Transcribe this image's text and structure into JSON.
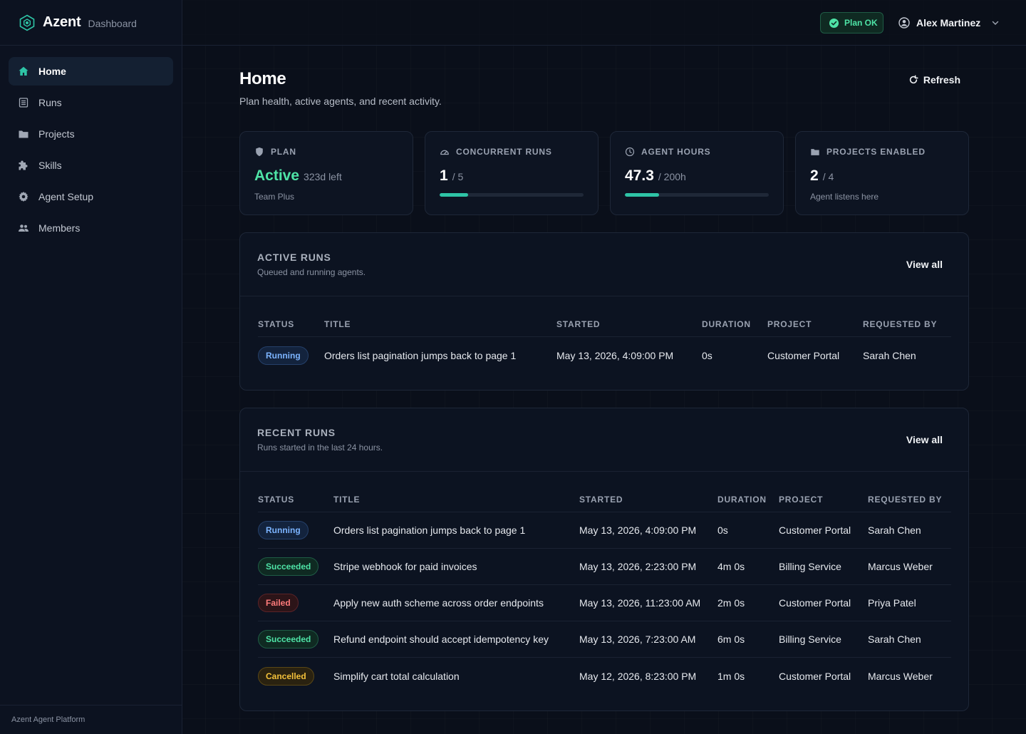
{
  "brand": {
    "name": "Azent",
    "sub": "Dashboard",
    "accent": "#2ec4a6"
  },
  "sidebar": {
    "items": [
      {
        "label": "Home",
        "icon": "home-icon",
        "active": true
      },
      {
        "label": "Runs",
        "icon": "list-icon"
      },
      {
        "label": "Projects",
        "icon": "folder-icon"
      },
      {
        "label": "Skills",
        "icon": "puzzle-icon"
      },
      {
        "label": "Agent Setup",
        "icon": "gear-icon"
      },
      {
        "label": "Members",
        "icon": "users-icon"
      }
    ],
    "footer": "Azent Agent Platform"
  },
  "topbar": {
    "plan_badge": "Plan OK",
    "user_name": "Alex Martinez"
  },
  "page": {
    "title": "Home",
    "subtitle": "Plan health, active agents, and recent activity.",
    "refresh_label": "Refresh"
  },
  "stats": {
    "plan": {
      "label": "PLAN",
      "value": "Active",
      "detail": "323d left",
      "note": "Team Plus"
    },
    "concurrent": {
      "label": "CONCURRENT RUNS",
      "value": "1",
      "total": "/ 5",
      "progress": 0.2
    },
    "hours": {
      "label": "AGENT HOURS",
      "value": "47.3",
      "total": "/ 200h",
      "progress": 0.2365
    },
    "projects": {
      "label": "PROJECTS ENABLED",
      "value": "2",
      "total": "/ 4",
      "note": "Agent listens here"
    }
  },
  "active_runs": {
    "title": "ACTIVE RUNS",
    "subtitle": "Queued and running agents.",
    "view_all": "View all",
    "columns": [
      "STATUS",
      "TITLE",
      "STARTED",
      "DURATION",
      "PROJECT",
      "REQUESTED BY"
    ],
    "rows": [
      {
        "status": "Running",
        "title": "Orders list pagination jumps back to page 1",
        "started": "May 13, 2026, 4:09:00 PM",
        "duration": "0s",
        "project": "Customer Portal",
        "requested_by": "Sarah Chen"
      }
    ]
  },
  "recent_runs": {
    "title": "RECENT RUNS",
    "subtitle": "Runs started in the last 24 hours.",
    "view_all": "View all",
    "columns": [
      "STATUS",
      "TITLE",
      "STARTED",
      "DURATION",
      "PROJECT",
      "REQUESTED BY"
    ],
    "rows": [
      {
        "status": "Running",
        "title": "Orders list pagination jumps back to page 1",
        "started": "May 13, 2026, 4:09:00 PM",
        "duration": "0s",
        "project": "Customer Portal",
        "requested_by": "Sarah Chen"
      },
      {
        "status": "Succeeded",
        "title": "Stripe webhook for paid invoices",
        "started": "May 13, 2026, 2:23:00 PM",
        "duration": "4m 0s",
        "project": "Billing Service",
        "requested_by": "Marcus Weber"
      },
      {
        "status": "Failed",
        "title": "Apply new auth scheme across order endpoints",
        "started": "May 13, 2026, 11:23:00 AM",
        "duration": "2m 0s",
        "project": "Customer Portal",
        "requested_by": "Priya Patel"
      },
      {
        "status": "Succeeded",
        "title": "Refund endpoint should accept idempotency key",
        "started": "May 13, 2026, 7:23:00 AM",
        "duration": "6m 0s",
        "project": "Billing Service",
        "requested_by": "Sarah Chen"
      },
      {
        "status": "Cancelled",
        "title": "Simplify cart total calculation",
        "started": "May 12, 2026, 8:23:00 PM",
        "duration": "1m 0s",
        "project": "Customer Portal",
        "requested_by": "Marcus Weber"
      }
    ]
  }
}
